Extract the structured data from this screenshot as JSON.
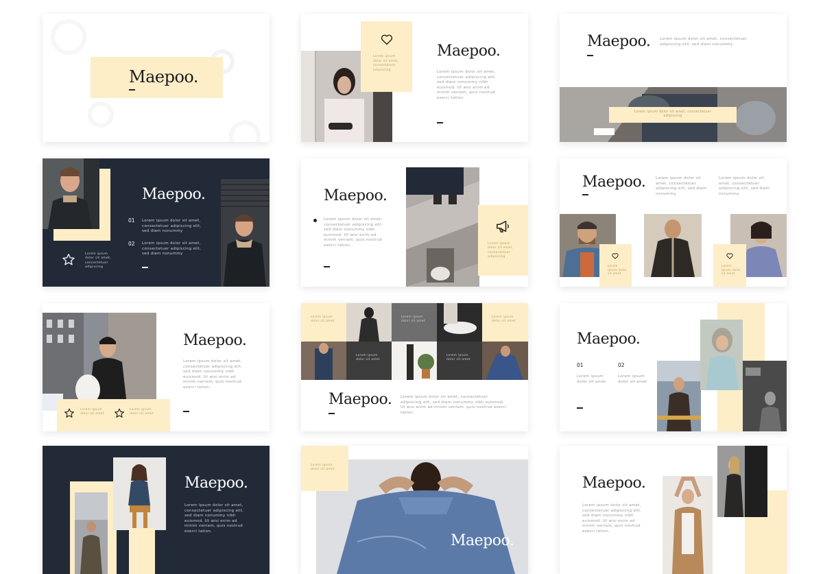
{
  "brand": "Maepoo.",
  "lorem_long": "Lorem ipsum dolor sit amet, consectetuer adipiscing elit, sed diam nonummy nibh euismod. Ut wisi enim ad minim veniam, quis nostrud exerci tation.",
  "lorem_mid": "Lorem ipsum dolor sit amet, consectetuer adipiscing elit, sed diam nonummy",
  "lorem_short": "Lorem ipsum dolor sit amet, consectetuer adipiscing",
  "lorem_tiny": "Lorem ipsum dolor sit amet",
  "lorem_caption": "Lorem ipsum dolor sit amet, consectetuer adipiscing elit, sed diam nonummy",
  "numbers": {
    "one": "01",
    "two": "02"
  },
  "colors": {
    "cream": "#fdeec8",
    "navy": "#222a38",
    "text": "#1d1d1d",
    "muted": "#9a9a9a"
  },
  "icons": [
    "heart-icon",
    "star-icon",
    "megaphone-icon"
  ]
}
